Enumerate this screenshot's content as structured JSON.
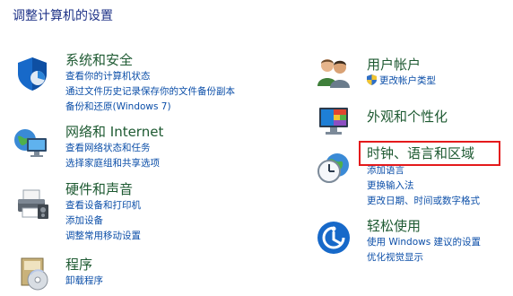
{
  "page_title": "调整计算机的设置",
  "left": [
    {
      "icon": "security-shield-icon",
      "title": "系统和安全",
      "links": [
        "查看你的计算机状态",
        "通过文件历史记录保存你的文件备份副本",
        "备份和还原(Windows 7)"
      ]
    },
    {
      "icon": "network-globe-icon",
      "title": "网络和 Internet",
      "links": [
        "查看网络状态和任务",
        "选择家庭组和共享选项"
      ]
    },
    {
      "icon": "printer-icon",
      "title": "硬件和声音",
      "links": [
        "查看设备和打印机",
        "添加设备",
        "调整常用移动设置"
      ]
    },
    {
      "icon": "programs-disk-icon",
      "title": "程序",
      "links": [
        "卸载程序"
      ]
    }
  ],
  "right": [
    {
      "icon": "users-icon",
      "title": "用户帐户",
      "links": [
        "更改帐户类型"
      ]
    },
    {
      "icon": "monitor-palette-icon",
      "title": "外观和个性化",
      "links": []
    },
    {
      "icon": "clock-globe-icon",
      "title": "时钟、语言和区域",
      "links": [
        "添加语言",
        "更换输入法",
        "更改日期、时间或数字格式"
      ]
    },
    {
      "icon": "ease-of-access-icon",
      "title": "轻松使用",
      "links": [
        "使用 Windows 建议的设置",
        "优化视觉显示"
      ]
    }
  ],
  "colors": {
    "title_text": "#1e3287",
    "category_title": "#1e5a32",
    "link": "#0b4ea8",
    "highlight": "#e41a1c"
  }
}
